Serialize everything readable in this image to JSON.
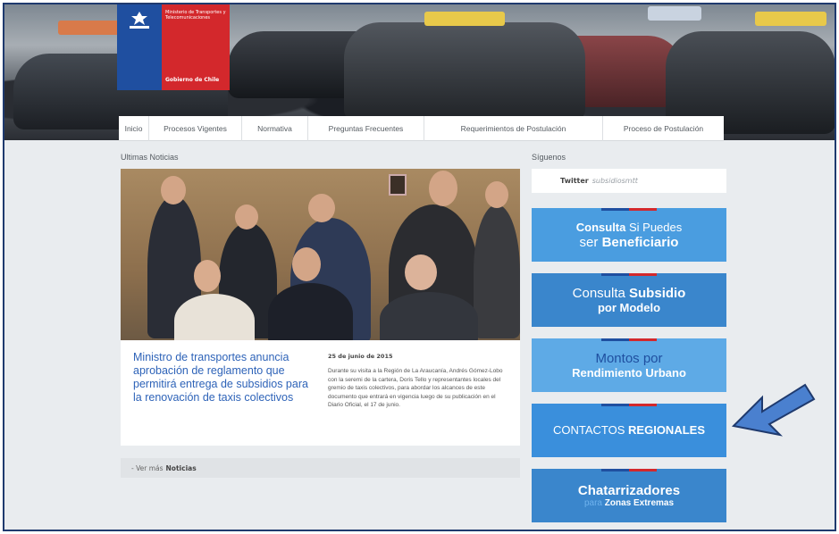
{
  "header": {
    "logo_ministry": "Ministerio de Transportes y Telecomunicaciones",
    "logo_gov": "Gobierno de Chile"
  },
  "nav": {
    "items": [
      {
        "label": "Inicio"
      },
      {
        "label": "Procesos Vigentes"
      },
      {
        "label": "Normativa"
      },
      {
        "label": "Preguntas Frecuentes"
      },
      {
        "label": "Requerimientos de Postulación"
      },
      {
        "label": "Proceso de Postulación"
      }
    ]
  },
  "news": {
    "section_title": "Ultimas Noticias",
    "headline": "Ministro de transportes anuncia aprobación de reglamento que permitirá entrega de subsidios para la renovación de taxis colectivos",
    "date": "25 de junio de 2015",
    "body": "Durante su visita a la Región de La Araucanía, Andrés Gómez-Lobo con la seremi de la cartera, Doris Tello y representantes locales del gremio de taxis colectivos, para abordar los alcances de este documento que entrará en vigencia luego de su publicación en el Diario Oficial, el 17 de junio.",
    "more_prefix": "- Ver más",
    "more_bold": "Noticias"
  },
  "sidebar": {
    "section_title": "Síguenos",
    "twitter_label": "Twitter",
    "twitter_handle": "subsidiosmtt",
    "buttons": [
      {
        "line1a": "Consulta",
        "line1b": " Si Puedes",
        "line2a": "ser ",
        "line2b": "Beneficiario"
      },
      {
        "line1a": "Consulta ",
        "line1b": "Subsidio",
        "line2": "por Modelo"
      },
      {
        "line1": "Montos por",
        "line2": "Rendimiento Urbano"
      },
      {
        "line1a": "CONTACTOS ",
        "line1b": "REGIONALES"
      },
      {
        "line1": "Chatarrizadores",
        "line2a": "para ",
        "line2b": "Zonas Extremas"
      }
    ]
  },
  "colors": {
    "accent_blue": "#2e63b8",
    "button_blue": "#3a86cc",
    "arrow_blue": "#4a80cf",
    "gov_red": "#d3282c",
    "gov_blue": "#1f4fa0"
  }
}
